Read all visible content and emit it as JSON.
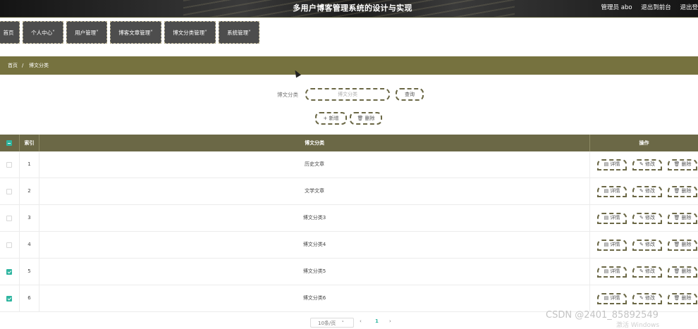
{
  "header": {
    "title": "多用户博客管理系统的设计与实现",
    "user": "管理员 abo",
    "front_link": "退出到前台",
    "logout": "退出登"
  },
  "nav": [
    {
      "label": "首页"
    },
    {
      "label": "个人中心"
    },
    {
      "label": "用户管理"
    },
    {
      "label": "博客文章管理"
    },
    {
      "label": "博文分类管理"
    },
    {
      "label": "系统管理"
    }
  ],
  "breadcrumb": {
    "home": "首页",
    "sep": "/",
    "current": "博文分类"
  },
  "search": {
    "label": "博文分类",
    "placeholder": "博文分类",
    "query_button": "查询",
    "add_button": "新增",
    "delete_button": "删除"
  },
  "table": {
    "headers": {
      "index": "索引",
      "category": "博文分类",
      "actions": "操作"
    },
    "rows": [
      {
        "index": "1",
        "category": "历史文章",
        "checked": false
      },
      {
        "index": "2",
        "category": "文学文章",
        "checked": false
      },
      {
        "index": "3",
        "category": "博文分类3",
        "checked": false
      },
      {
        "index": "4",
        "category": "博文分类4",
        "checked": false
      },
      {
        "index": "5",
        "category": "博文分类5",
        "checked": true
      },
      {
        "index": "6",
        "category": "博文分类6",
        "checked": true
      }
    ],
    "row_actions": {
      "detail": "详情",
      "edit": "修改",
      "delete": "删除"
    }
  },
  "pager": {
    "page_size": "10条/页",
    "prev": "‹",
    "current": "1",
    "next": "›"
  },
  "watermarks": {
    "csdn": "CSDN @2401_85892549",
    "windows": "激活 Windows"
  },
  "colors": {
    "olive": "#6b6846",
    "breadcrumb": "#76723f",
    "nav": "#4d4d4d",
    "checkbox": "#2fb5a0"
  }
}
